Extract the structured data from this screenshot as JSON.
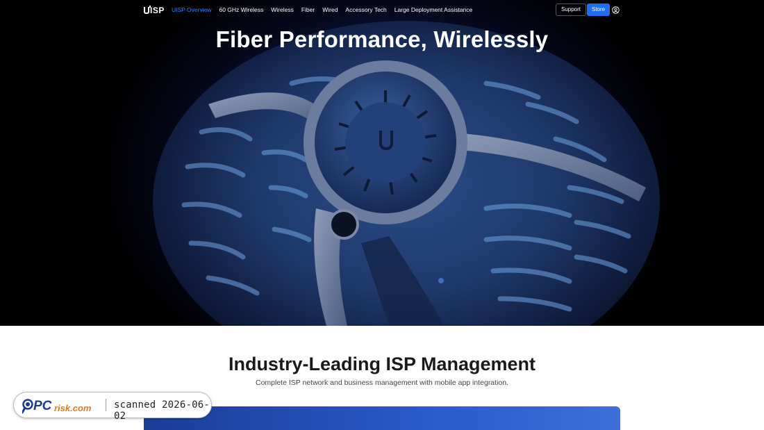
{
  "nav": {
    "logo": "UISP",
    "links": [
      "UISP Overview",
      "60 GHz Wireless",
      "Wireless",
      "Fiber",
      "Wired",
      "Accessory Tech",
      "Large Deployment Assistance"
    ],
    "active_index": 0,
    "support_label": "Support",
    "store_label": "Store",
    "account_icon": "account-circle-icon"
  },
  "hero": {
    "title": "Fiber Performance, Wirelessly"
  },
  "section2": {
    "title": "Industry-Leading ISP Management",
    "subtitle": "Complete ISP network and business management with mobile app integration."
  },
  "badge": {
    "logo_text": "PCrisk.com",
    "text": "scanned 2026-06-02"
  },
  "colors": {
    "accent": "#2a84ff",
    "store_button": "#1f6ff0",
    "hero_glow": "#1a2f75"
  }
}
